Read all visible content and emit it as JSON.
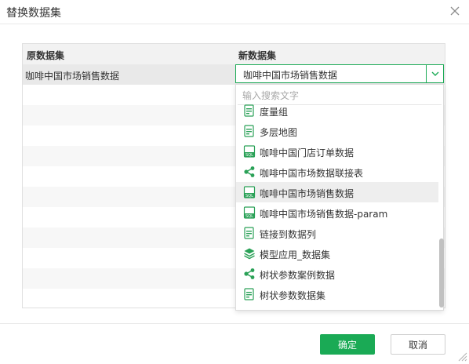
{
  "dialog": {
    "title": "替换数据集",
    "close_label": "close"
  },
  "table": {
    "col_original": "原数据集",
    "col_new": "新数据集",
    "rows": [
      {
        "original": "咖啡中国市场销售数据",
        "new": "咖啡中国市场销售数据"
      }
    ]
  },
  "select": {
    "value": "咖啡中国市场销售数据"
  },
  "dropdown": {
    "search_placeholder": "输入搜索文字",
    "items": [
      {
        "label": "度量组",
        "icon": "dataset-icon"
      },
      {
        "label": "多层地图",
        "icon": "dataset-icon"
      },
      {
        "label": "咖啡中国门店订单数据",
        "icon": "sql-dataset-icon"
      },
      {
        "label": "咖啡中国市场数据联接表",
        "icon": "join-dataset-icon"
      },
      {
        "label": "咖啡中国市场销售数据",
        "icon": "sql-dataset-icon"
      },
      {
        "label": "咖啡中国市场销售数据-param",
        "icon": "sql-dataset-icon"
      },
      {
        "label": "链接到数据列",
        "icon": "dataset-icon"
      },
      {
        "label": "模型应用_数据集",
        "icon": "model-dataset-icon"
      },
      {
        "label": "树状参数案例数据",
        "icon": "join-dataset-icon"
      },
      {
        "label": "树状参数数据集",
        "icon": "dataset-icon"
      }
    ],
    "active_index": 4
  },
  "footer": {
    "ok_label": "确定",
    "cancel_label": "取消"
  },
  "colors": {
    "accent": "#1aaa55",
    "sql_icon": "#2aa157",
    "border": "#e0e0e0"
  }
}
